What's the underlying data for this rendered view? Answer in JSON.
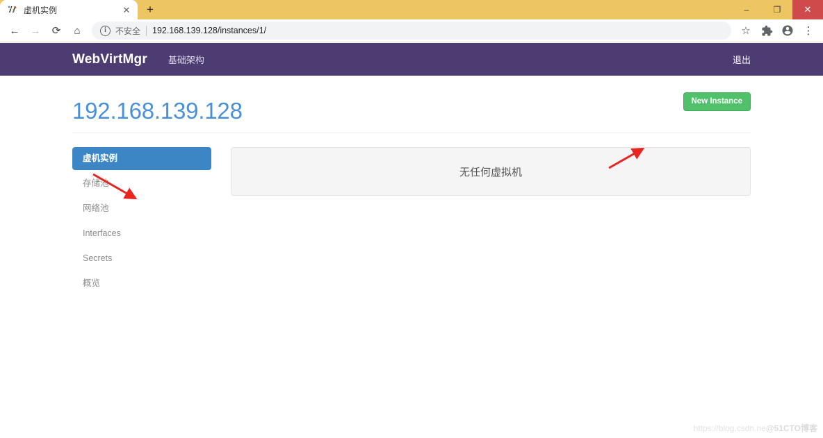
{
  "browser": {
    "tab": {
      "title": "虚机实例",
      "favicon_icon": "app-favicon-icon",
      "close_icon": "✕"
    },
    "new_tab_label": "+",
    "window_controls": {
      "minimize": "–",
      "maximize": "❐",
      "close": "✕"
    },
    "toolbar": {
      "back_icon": "←",
      "forward_icon": "→",
      "reload_icon": "⟳",
      "home_icon": "⌂",
      "security_icon": "i",
      "security_label": "不安全",
      "url": "192.168.139.128/instances/1/",
      "bookmark_icon": "☆",
      "extensions_icon": "puzzle-piece-icon",
      "profile_icon": "account-circle-icon",
      "menu_icon": "⋮"
    }
  },
  "navbar": {
    "brand": "WebVirtMgr",
    "links": [
      {
        "label": "基础架构"
      }
    ],
    "right_links": [
      {
        "label": "退出"
      }
    ],
    "background_color": "#4d3c71"
  },
  "page": {
    "title": "192.168.139.128",
    "title_color": "#4a90d9",
    "new_instance_button": "New Instance",
    "new_instance_color": "#51c06a"
  },
  "sidebar": {
    "items": [
      {
        "label": "虚机实例",
        "active": true
      },
      {
        "label": "存储池",
        "active": false
      },
      {
        "label": "网络池",
        "active": false
      },
      {
        "label": "Interfaces",
        "active": false
      },
      {
        "label": "Secrets",
        "active": false
      },
      {
        "label": "概览",
        "active": false
      }
    ],
    "active_color": "#3d86c6"
  },
  "main": {
    "empty_message": "无任何虚拟机"
  },
  "annotations": {
    "arrow_color": "#e8251f",
    "arrows": [
      {
        "name": "arrow-to-sidebar-active-item"
      },
      {
        "name": "arrow-to-new-instance-button"
      }
    ]
  },
  "watermark": {
    "url_text": "https://blog.csdn.ne",
    "brand_text": "@51CTO博客"
  }
}
